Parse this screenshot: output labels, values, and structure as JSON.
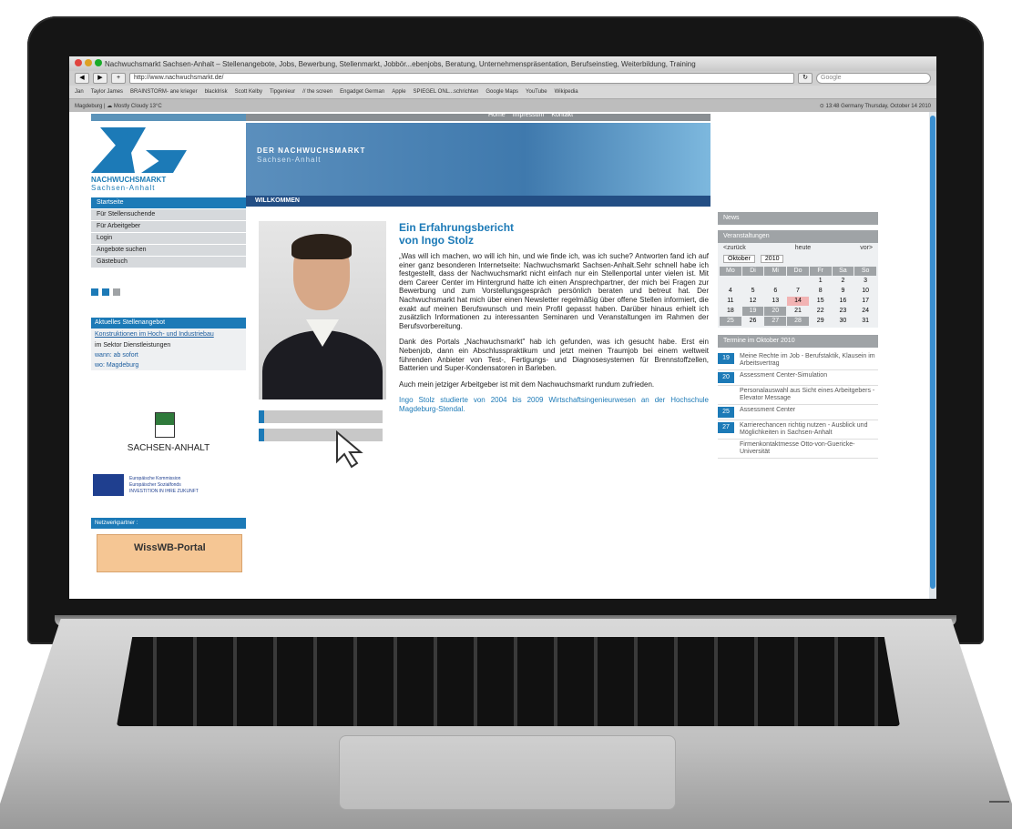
{
  "browser": {
    "window_title": "Nachwuchsmarkt Sachsen-Anhalt – Stellenangebote, Jobs, Bewerbung, Stellenmarkt, Jobbör...ebenjobs, Beratung, Unternehmenspräsentation, Berufseinstieg, Weiterbildung, Training",
    "url": "http://www.nachwuchsmarkt.de/",
    "search_placeholder": "Google",
    "bookmarks": [
      "Jan",
      "Taylor James",
      "BRAINSTORM- ane krieger",
      "blackIrisk",
      "Scott Kelby",
      "Tipgenieur",
      "// the screen",
      "Engadget German",
      "Apple",
      "SPIEGEL ONL...schrichten",
      "Google Maps",
      "YouTube",
      "Wikipedia"
    ],
    "status_left": "Magdeburg | ☁ Mostly Cloudy 13°C",
    "status_right": "⊙ 13:48 Germany   Thursday, October 14 2010"
  },
  "topnav": [
    "Home",
    "Impressum",
    "Kontakt"
  ],
  "logo": {
    "line1": "NACHWUCHSMARKT",
    "line2": "Sachsen-Anhalt"
  },
  "banner": {
    "title": "DER NACHWUCHSMARKT",
    "subtitle": "Sachsen-Anhalt",
    "section": "WILLKOMMEN"
  },
  "leftnav": [
    "Startseite",
    "Für Stellensuchende",
    "Für Arbeitgeber",
    "Login",
    "Angebote suchen",
    "Gästebuch"
  ],
  "angebot": {
    "title": "Aktuelles Stellenangebot",
    "link": "Konstruktionen im Hoch- und Industriebau",
    "line": "im Sektor Dienstleistungen",
    "extra1": "wann: ab sofort",
    "extra2": "wo: Magdeburg"
  },
  "sachsen_label": "SACHSEN-ANHALT",
  "eu_text": [
    "Europäische Kommission",
    "Europäischer Sozialfonds",
    "INVESTITION IN IHRE ZUKUNFT"
  ],
  "netzwerk_label": "Netzwerkpartner :",
  "wiss_label": "WissWB-Portal",
  "article": {
    "title_line1": "Ein Erfahrungsbericht",
    "title_line2": "von Ingo Stolz",
    "p1": "„Was will ich machen, wo will ich hin, und wie finde ich, was ich suche? Antworten fand ich auf einer ganz besonderen Internetseite: Nachwuchsmarkt Sachsen-Anhalt.Sehr schnell habe ich festgestellt, dass der Nachwuchsmarkt nicht einfach nur ein Stellenportal unter vielen ist. Mit dem Career Center im Hintergrund hatte ich einen Ansprechpartner, der mich bei Fragen zur Bewerbung und zum Vorstellungsgespräch persönlich beraten und betreut hat. Der Nachwuchsmarkt hat mich über einen Newsletter regelmäßig über offene Stellen informiert, die exakt auf meinen Berufswunsch und mein Profil gepasst haben. Darüber hinaus erhielt ich zusätzlich Informationen zu interessanten Seminaren und Veranstaltungen im Rahmen der Berufsvorbereitung.",
    "p2": "Dank des Portals „Nachwuchsmarkt\" hab ich gefunden, was ich gesucht habe. Erst ein Nebenjob, dann ein Abschlusspraktikum und jetzt meinen Traumjob bei einem weltweit führenden Anbieter von Test-, Fertigungs- und Diagnosesystemen für Brennstoffzellen, Batterien und Super-Kondensatoren in Barleben.",
    "p3": "Auch mein jetziger Arbeitgeber ist mit dem Nachwuchsmarkt rundum zufrieden.",
    "p4": "Ingo Stolz studierte von 2004 bis 2009 Wirtschaftsingenieurwesen an der Hochschule Magdeburg-Stendal."
  },
  "news_label": "News",
  "calendar": {
    "title": "Veranstaltungen",
    "prev": "<zurück",
    "today": "heute",
    "next": "vor>",
    "month": "Oktober",
    "year": "2010",
    "dow": [
      "Mo",
      "Di",
      "Mi",
      "Do",
      "Fr",
      "Sa",
      "So"
    ],
    "days": [
      "",
      "",
      "",
      "",
      "1",
      "2",
      "3",
      "4",
      "5",
      "6",
      "7",
      "8",
      "9",
      "10",
      "11",
      "12",
      "13",
      "14",
      "15",
      "16",
      "17",
      "18",
      "19",
      "20",
      "21",
      "22",
      "23",
      "24",
      "25",
      "26",
      "27",
      "28",
      "29",
      "30",
      "31"
    ],
    "today_day": "14",
    "highlight_days": [
      "19",
      "20",
      "25",
      "27",
      "28"
    ]
  },
  "termine": {
    "title": "Termine im Oktober 2010",
    "items": [
      {
        "date": "19",
        "text": "Meine Rechte im Job - Berufstaktik, Klausein im Arbeitsvertrag"
      },
      {
        "date": "20",
        "text": "Assessment Center-Simulation"
      },
      {
        "date": "",
        "text": "Personalauswahl aus Sicht eines Arbeitgebers - Elevator Message"
      },
      {
        "date": "25",
        "text": "Assessment Center"
      },
      {
        "date": "27",
        "text": "Karrierechancen richtig nutzen - Ausblick und Möglichkeiten in Sachsen-Anhalt"
      },
      {
        "date": "",
        "text": "Firmenkontaktmesse Otto-von-Guericke-Universität"
      }
    ]
  },
  "colors": {
    "accent": "#1c7ab7",
    "dark_blue": "#234e84",
    "gray": "#9fa3a6"
  }
}
